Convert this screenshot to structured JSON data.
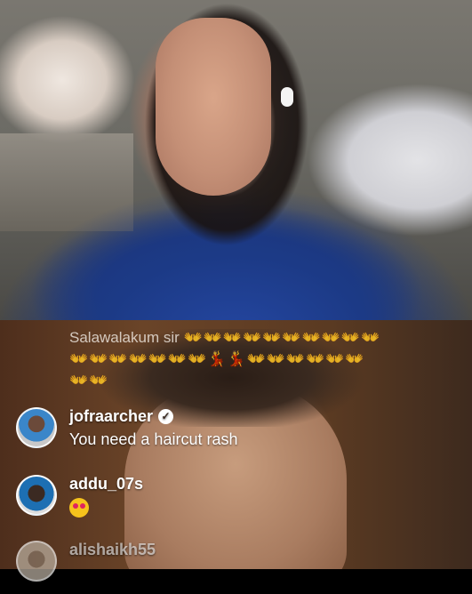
{
  "top_feed": {
    "description_icon": "live-video-feed"
  },
  "bottom_feed": {
    "description_icon": "live-video-feed"
  },
  "comments": {
    "previous_message": {
      "text": "Salawalakum sir",
      "emoji_line_1": "👐👐👐👐👐👐👐👐👐👐",
      "emoji_line_2": "👐👐👐👐👐👐👐💃💃👐👐👐👐👐👐",
      "emoji_line_3": "👐👐"
    },
    "items": [
      {
        "username": "jofraarcher",
        "verified_icon": "verified-check-icon",
        "text": "You need a haircut rash"
      },
      {
        "username": "addu_07s",
        "text": "heart-eyes"
      },
      {
        "username": "alishaikh55",
        "text": ""
      }
    ]
  }
}
